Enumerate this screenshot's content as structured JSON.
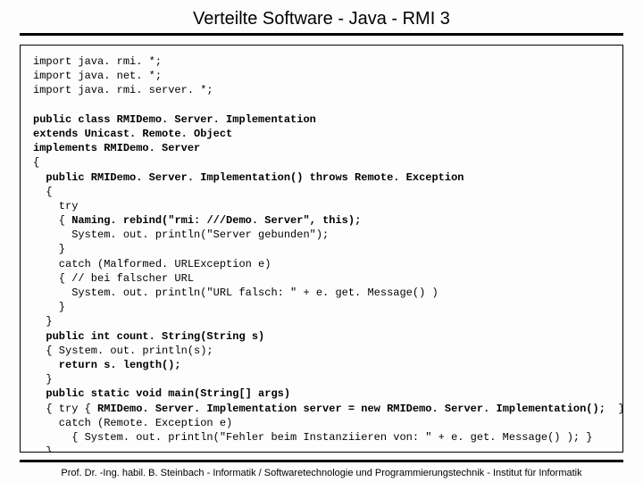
{
  "title": "Verteilte Software - Java - RMI 3",
  "code": {
    "l01": "import java. rmi. *;",
    "l02": "import java. net. *;",
    "l03": "import java. rmi. server. *;",
    "l04": "",
    "l05a": "public class RMIDemo. Server. Implementation",
    "l06a": "extends Unicast. Remote. Object",
    "l07a": "implements RMIDemo. Server",
    "l08": "{",
    "l09a": "  public RMIDemo. Server. Implementation() throws Remote. Exception",
    "l10": "  {",
    "l11": "    try",
    "l12a": "    { ",
    "l12b": "Naming. rebind(\"rmi: ///Demo. Server\", this);",
    "l13": "      System. out. println(\"Server gebunden\");",
    "l14": "    }",
    "l15": "    catch (Malformed. URLException e)",
    "l16": "    { // bei falscher URL",
    "l17": "      System. out. println(\"URL falsch: \" + e. get. Message() )",
    "l18": "    }",
    "l19": "  }",
    "l20a": "  public int count. String(String s)",
    "l21": "  { System. out. println(s);",
    "l22a": "    return s. length();",
    "l23": "  }",
    "l24a": "  public static void main(String[] args)",
    "l25a": "  { try { ",
    "l25b": "RMIDemo. Server. Implementation server = new RMIDemo. Server. Implementation();",
    "l25c": "  }",
    "l26": "    catch (Remote. Exception e)",
    "l27": "      { System. out. println(\"Fehler beim Instanziieren von: \" + e. get. Message() ); }",
    "l28": "  }",
    "l29": "}"
  },
  "footer": "Prof. Dr. -Ing. habil. B. Steinbach - Informatik / Softwaretechnologie und Programmierungstechnik - Institut für Informatik"
}
